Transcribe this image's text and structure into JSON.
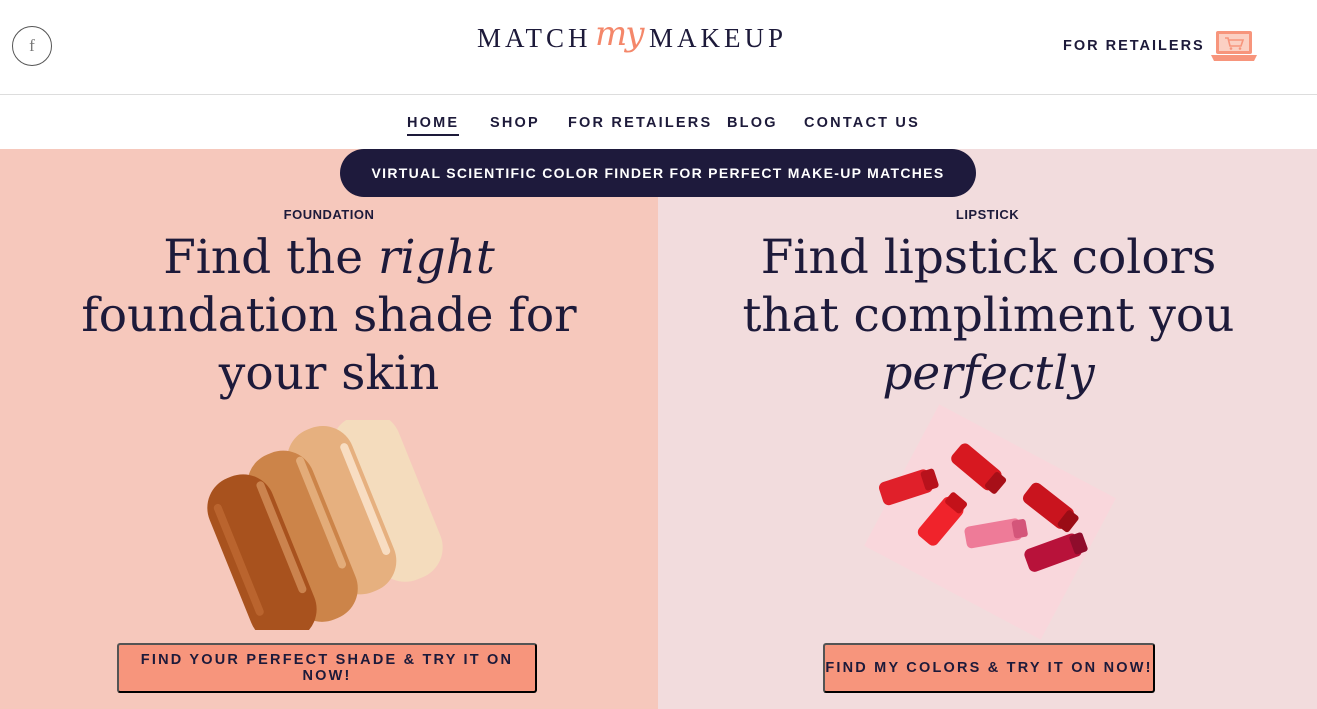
{
  "header": {
    "social_icon": "facebook-icon",
    "logo": {
      "left": "MATCH",
      "script": "my",
      "right": "MAKEUP"
    },
    "retailers_link": "FOR RETAILERS",
    "cart_icon": "laptop-cart-icon"
  },
  "nav": {
    "items": [
      {
        "label": "HOME",
        "active": true
      },
      {
        "label": "SHOP"
      },
      {
        "label": "FOR RETAILERS"
      },
      {
        "label": "BLOG"
      },
      {
        "label": "CONTACT US"
      }
    ]
  },
  "banner": "VIRTUAL SCIENTIFIC COLOR FINDER FOR PERFECT MAKE-UP MATCHES",
  "foundation": {
    "kicker": "FOUNDATION",
    "headline_part1": "Find the ",
    "headline_em": "right",
    "headline_line2": "foundation shade for",
    "headline_line3": "your skin",
    "cta": "FIND YOUR PERFECT SHADE & TRY IT ON NOW!"
  },
  "lipstick": {
    "kicker": "LIPSTICK",
    "headline_line1": "Find lipstick colors",
    "headline_line2": "that compliment you",
    "headline_em": "perfectly",
    "cta": "FIND MY COLORS & TRY IT ON NOW!"
  },
  "colors": {
    "navy": "#1d1a3a",
    "coral": "#f7957c",
    "peach_panel": "#f6c8bc",
    "pink_panel": "#f2dcdd",
    "logo_script": "#f4876a"
  }
}
